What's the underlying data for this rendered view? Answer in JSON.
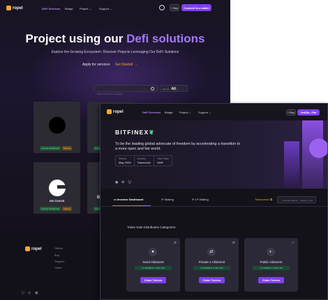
{
  "brand": {
    "name": "ropel"
  },
  "back": {
    "nav": {
      "items": [
        "DeFi Services",
        "Bridge",
        "Project",
        "Support"
      ],
      "buy_label": "+ Buy",
      "cta_label": "Connect to a wallet"
    },
    "hero": {
      "title_plain": "Project using our ",
      "title_highlight": "Defi solutions",
      "subtitle": "Explore the Growing Ecosystem: Discover Projects Leveraging Our DeFi Solutions",
      "apply_label": "Apply for services",
      "get_started": "Get Started"
    },
    "search": {
      "placeholder": "Search for name of projects"
    },
    "sort": {
      "label": "Sort by",
      "value": "All"
    },
    "cards": [
      {
        "tag1": "Investor Dashboard",
        "tag2": "Staking"
      },
      {
        "name": "DELTAHUB",
        "tag1": "Investor Dashboard",
        "tag2": "Staking"
      }
    ],
    "card_partial_letter": "B",
    "footer": {
      "links": [
        "Gitbook",
        "Blog",
        "Telegram",
        "Twitter"
      ]
    }
  },
  "front": {
    "nav": {
      "items": [
        "DeFi Services",
        "Bridge",
        "Project",
        "Support"
      ],
      "buy_label": "+ Buy",
      "cta_label": "0x4f3a...f3af"
    },
    "project": {
      "name": "BITFINEX",
      "description": "To be the leading global advocate of freedom by accelerating a transition to a more open and fair world.",
      "stats": [
        {
          "label": "Started",
          "value": "May 2025"
        },
        {
          "label": "Industry",
          "value": "Tokenomic"
        },
        {
          "label": "Total Raise",
          "value": "100K"
        }
      ]
    },
    "tabs": [
      "Investor Dashboard",
      "Staking",
      "LP Staking"
    ],
    "tokenomics_label": "Tokenomics",
    "contract": {
      "label": "Contract Address",
      "value": "0xa1b4...f2c2"
    },
    "categories_title": "Token Sale Distribution Categories:",
    "allocations": [
      {
        "name": "Seed Allotment",
        "claimable": "CLAIMABLE: 3,962 LED",
        "button": "Claim Tokens"
      },
      {
        "name": "Private-1 Allotment",
        "claimable": "CLAIMABLE: 3,962 LED",
        "button": "Claim Tokens"
      },
      {
        "name": "Public Allotment",
        "claimable": "CLAIMABLE: 3,962 LED",
        "button": "Claim Tokens"
      }
    ]
  },
  "colors": {
    "accent": "#7f3ff2",
    "highlight": "#a678ff",
    "orange": "#f1a33a",
    "green": "#5ed09a"
  },
  "icons": [
    "user-icon",
    "search-icon",
    "chevron-down-icon",
    "arrow-right-icon",
    "telegram-icon",
    "twitter-icon",
    "github-icon",
    "instagram-icon",
    "leaf-icon",
    "dashboard-icon",
    "staking-icon",
    "copy-icon"
  ]
}
